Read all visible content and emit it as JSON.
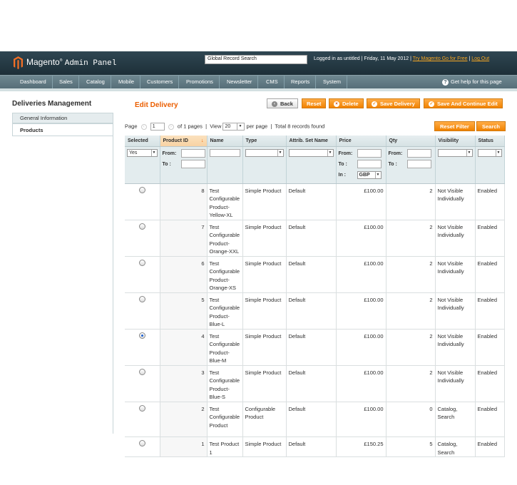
{
  "header": {
    "logo_name": "Magento",
    "logo_tm": "®",
    "logo_suffix": "Admin Panel",
    "search_value": "Global Record Search",
    "logged_in": "Logged in as untitled",
    "separator": "|",
    "date": "Friday, 11 May 2012",
    "try_link": "Try Magento Go for Free",
    "logout_link": "Log Out"
  },
  "nav": {
    "items": [
      "Dashboard",
      "Sales",
      "Catalog",
      "Mobile",
      "Customers",
      "Promotions",
      "Newsletter",
      "CMS",
      "Reports",
      "System"
    ],
    "help": "Get help for this page"
  },
  "sidebar": {
    "title": "Deliveries Management",
    "tabs": [
      "General Information",
      "Products"
    ],
    "active_tab": "Products"
  },
  "page": {
    "title": "Edit Delivery",
    "buttons": {
      "back": "Back",
      "reset": "Reset",
      "delete": "Delete",
      "save": "Save Delivery",
      "save_continue": "Save And Continue Edit"
    }
  },
  "pager": {
    "page_label": "Page",
    "page_value": "1",
    "of_pages": "of 1 pages",
    "view_label": "View",
    "per_page_value": "20",
    "per_page_label": "per page",
    "total": "Total 8 records found",
    "reset_filter": "Reset Filter",
    "search": "Search"
  },
  "grid": {
    "columns": [
      "Selected",
      "Product ID",
      "Name",
      "Type",
      "Attrib. Set Name",
      "Price",
      "Qty",
      "Visibility",
      "Status"
    ],
    "sorted_column": "Product ID",
    "filters": {
      "selected": "Yes",
      "from_label": "From:",
      "to_label": "To :",
      "in_label": "In :",
      "currency": "GBP"
    },
    "rows": [
      {
        "selected": false,
        "id": "8",
        "name": "Test Configurable Product-Yellow-XL",
        "type": "Simple Product",
        "attrib": "Default",
        "price": "£100.00",
        "qty": "2",
        "visibility": "Not Visible Individually",
        "status": "Enabled"
      },
      {
        "selected": false,
        "id": "7",
        "name": "Test Configurable Product-Orange-XXL",
        "type": "Simple Product",
        "attrib": "Default",
        "price": "£100.00",
        "qty": "2",
        "visibility": "Not Visible Individually",
        "status": "Enabled"
      },
      {
        "selected": false,
        "id": "6",
        "name": "Test Configurable Product-Orange-XS",
        "type": "Simple Product",
        "attrib": "Default",
        "price": "£100.00",
        "qty": "2",
        "visibility": "Not Visible Individually",
        "status": "Enabled"
      },
      {
        "selected": false,
        "id": "5",
        "name": "Test Configurable Product-Blue-L",
        "type": "Simple Product",
        "attrib": "Default",
        "price": "£100.00",
        "qty": "2",
        "visibility": "Not Visible Individually",
        "status": "Enabled"
      },
      {
        "selected": true,
        "id": "4",
        "name": "Test Configurable Product-Blue-M",
        "type": "Simple Product",
        "attrib": "Default",
        "price": "£100.00",
        "qty": "2",
        "visibility": "Not Visible Individually",
        "status": "Enabled"
      },
      {
        "selected": false,
        "id": "3",
        "name": "Test Configurable Product-Blue-S",
        "type": "Simple Product",
        "attrib": "Default",
        "price": "£100.00",
        "qty": "2",
        "visibility": "Not Visible Individually",
        "status": "Enabled"
      },
      {
        "selected": false,
        "id": "2",
        "name": "Test Configurable Product",
        "type": "Configurable Product",
        "attrib": "Default",
        "price": "£100.00",
        "qty": "0",
        "visibility": "Catalog, Search",
        "status": "Enabled"
      },
      {
        "selected": false,
        "id": "1",
        "name": "Test Product 1",
        "type": "Simple Product",
        "attrib": "Default",
        "price": "£150.25",
        "qty": "5",
        "visibility": "Catalog, Search",
        "status": "Enabled"
      }
    ]
  },
  "colors": {
    "accent": "#eb5e00",
    "button": "#f18200",
    "header_bg": "#2a3f4a",
    "nav_bg": "#607a84",
    "selected_radio": "#1b5fd1"
  }
}
